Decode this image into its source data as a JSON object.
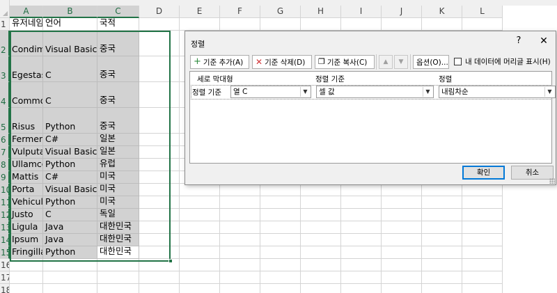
{
  "columns": [
    "A",
    "B",
    "C",
    "D",
    "E",
    "F",
    "G",
    "H",
    "I",
    "J",
    "K",
    "L"
  ],
  "rows": [
    [
      "유저네임",
      "언어",
      "국적"
    ],
    [
      "Condimentum",
      "Visual Basic",
      "중국"
    ],
    [
      "Egestas",
      "C",
      "중국"
    ],
    [
      "Commodo",
      "C",
      "중국"
    ],
    [
      "Risus",
      "Python",
      "중국"
    ],
    [
      "Fermentum",
      "C#",
      "일본"
    ],
    [
      "Vulputate",
      "Visual Basic",
      "일본"
    ],
    [
      "Ullamcorper",
      "Python",
      "유럽"
    ],
    [
      "Mattis",
      "C#",
      "미국"
    ],
    [
      "Porta",
      "Visual Basic",
      "미국"
    ],
    [
      "Vehicula",
      "Python",
      "미국"
    ],
    [
      "Justo",
      "C",
      "독일"
    ],
    [
      "Ligula",
      "Java",
      "대한민국"
    ],
    [
      "Ipsum",
      "Java",
      "대한민국"
    ],
    [
      "Fringilla",
      "Python",
      "대한민국"
    ],
    [
      "",
      "",
      ""
    ],
    [
      "",
      "",
      ""
    ],
    [
      "",
      "",
      ""
    ]
  ],
  "row_numbers": [
    "1",
    "2",
    "3",
    "4",
    "5",
    "6",
    "7",
    "8",
    "9",
    "10",
    "11",
    "12",
    "13",
    "14",
    "15",
    "16",
    "17",
    "18"
  ],
  "dialog": {
    "title": "정렬",
    "help": "?",
    "close": "✕",
    "toolbar": {
      "add_level": "기준 추가(A)",
      "delete_level": "기준 삭제(D)",
      "copy_level": "기준 복사(C)",
      "move_up": "▲",
      "move_down": "▼",
      "options": "옵션(O)...",
      "has_headers": "내 데이터에 머리글 표시(H)"
    },
    "headers": {
      "column": "세로 막대형",
      "sort_on": "정렬 기준",
      "order": "정렬"
    },
    "level": {
      "label": "정렬 기준",
      "column_value": "열 C",
      "sort_on_value": "셀 값",
      "order_value": "내림차순"
    },
    "ok": "확인",
    "cancel": "취소"
  },
  "colors": {
    "selection_border": "#217346",
    "selection_fill": "#d2d2d2",
    "add_icon": "#2e8b3e",
    "delete_icon": "#d13438"
  },
  "icons": [
    "plus-icon",
    "x-icon",
    "copy-icon",
    "chevron-up-icon",
    "chevron-down-icon",
    "checkbox-icon",
    "dropdown-icon"
  ]
}
